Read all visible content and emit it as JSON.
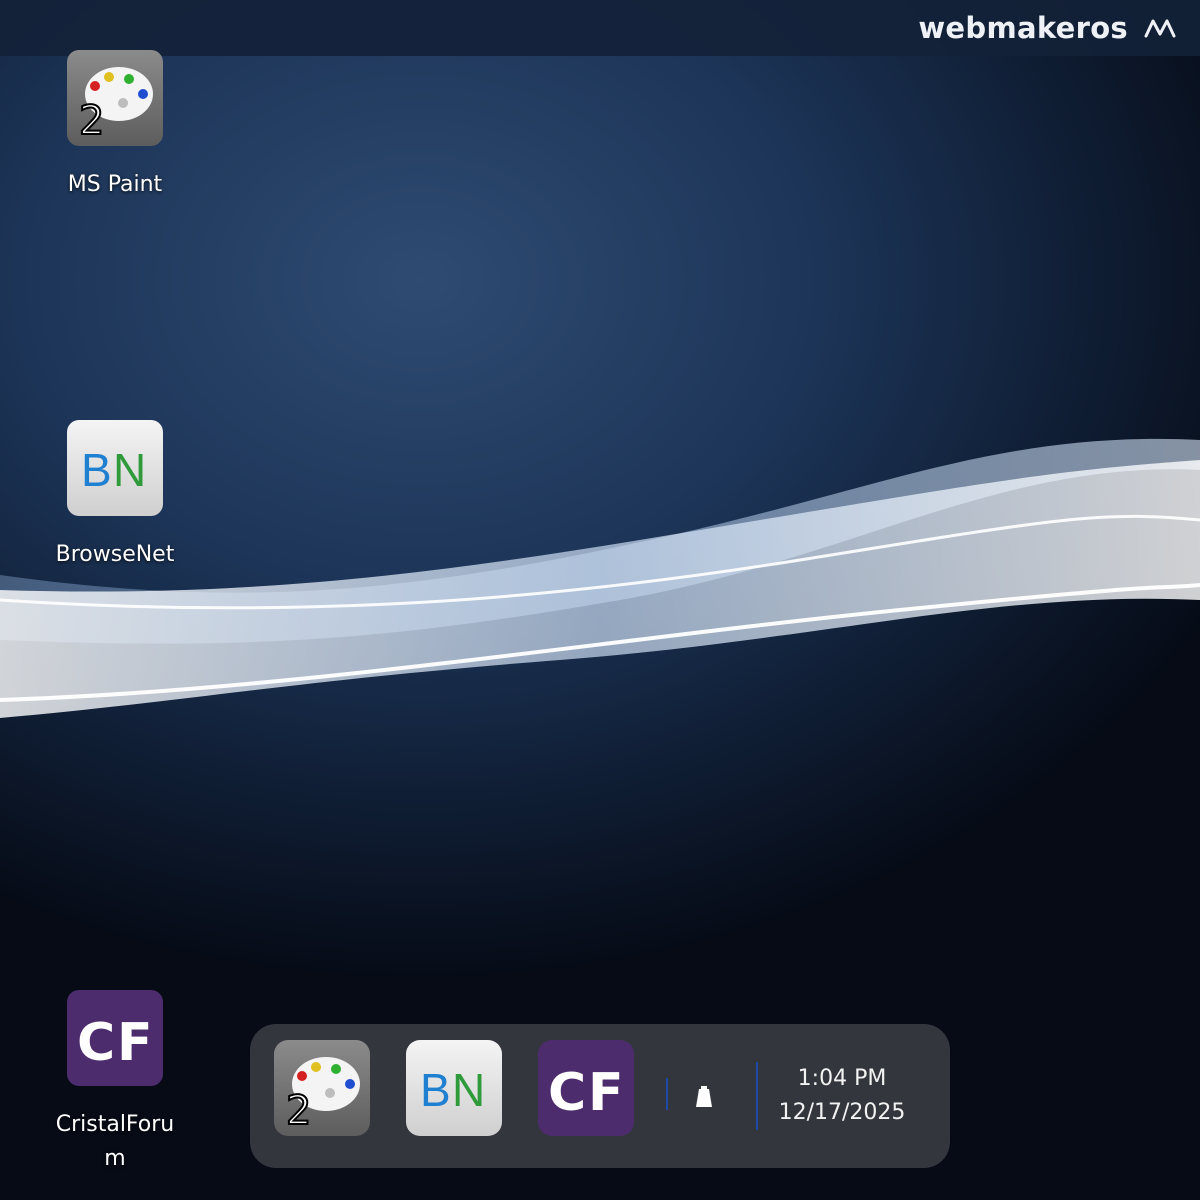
{
  "topbar": {
    "brand": "webmakeros",
    "logo_icon": "webmakeros-logo-icon"
  },
  "desktop": {
    "icons": [
      {
        "label": "MS Paint",
        "icon": "paint-palette-icon"
      },
      {
        "label": "BrowseNet",
        "icon": "browsenet-icon",
        "badge": "BN"
      },
      {
        "label": "CristalForum",
        "icon": "cristalforum-icon",
        "badge": "CF"
      }
    ]
  },
  "taskbar": {
    "apps": [
      {
        "name": "MS Paint",
        "icon": "paint-palette-icon"
      },
      {
        "name": "BrowseNet",
        "icon": "browsenet-icon",
        "badge": "BN"
      },
      {
        "name": "CristalForum",
        "icon": "cristalforum-icon",
        "badge": "CF"
      }
    ],
    "tray_icon": "battery-icon",
    "time": "1:04 PM",
    "date": "12/17/2025"
  },
  "colors": {
    "accent": "#1e4aa6",
    "cf_purple": "#4d2c6e"
  }
}
